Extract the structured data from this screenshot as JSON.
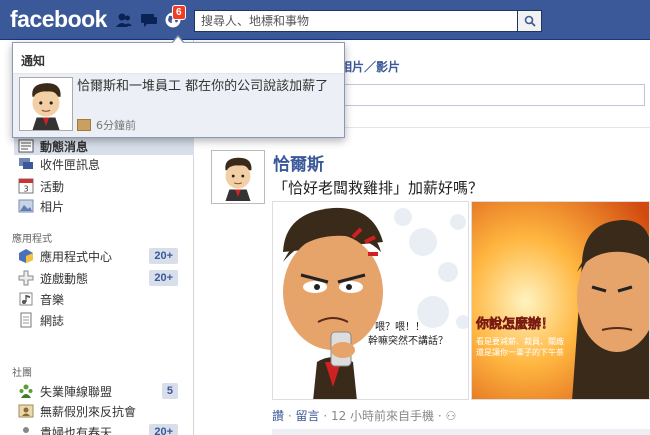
{
  "topbar": {
    "logo": "facebook",
    "notif_count": "6",
    "search_placeholder": "搜尋人、地標和事物"
  },
  "notifications": {
    "header": "通知",
    "item": {
      "text": "恰爾斯和一堆員工 都在你的公司說該加薪了",
      "time": "6分鐘前"
    }
  },
  "sidebar": {
    "items": [
      {
        "label": "動態消息",
        "icon": "news-feed-icon"
      },
      {
        "label": "收件匣訊息",
        "icon": "messages-icon"
      },
      {
        "label": "活動",
        "icon": "calendar-icon"
      },
      {
        "label": "相片",
        "icon": "photos-icon"
      }
    ],
    "apps_header": "應用程式",
    "apps": [
      {
        "label": "應用程式中心",
        "count": "20+",
        "icon": "app-center-icon"
      },
      {
        "label": "遊戲動態",
        "count": "20+",
        "icon": "games-icon"
      },
      {
        "label": "音樂",
        "icon": "music-icon"
      },
      {
        "label": "網誌",
        "icon": "notes-icon"
      }
    ],
    "groups_header": "社團",
    "groups": [
      {
        "label": "失業陣線聯盟",
        "count": "5",
        "icon": "group-icon"
      },
      {
        "label": "無薪假別來反抗會",
        "icon": "group-icon"
      },
      {
        "label": "貴婦也有春天",
        "count": "20+",
        "icon": "group-icon"
      }
    ]
  },
  "composer": {
    "tab_label": "相片／影片"
  },
  "post": {
    "author": "恰爾斯",
    "text": "「恰好老闆救雞排」加薪好嗎？",
    "photo1_caption": "喂？喂！！\n幹嘛突然不講話？",
    "photo2_title": "你說怎麼辦！",
    "photo2_caption": "看是要減薪、裁員、關廠\n還是讓你一輩子的下午茶",
    "meta_like": "讚",
    "meta_comment": "留言",
    "meta_rest": "· 12 小時前來自手機 ·"
  },
  "colors": {
    "brand": "#3b5998",
    "badge": "#f03d25",
    "selected": "#d8dfea"
  }
}
